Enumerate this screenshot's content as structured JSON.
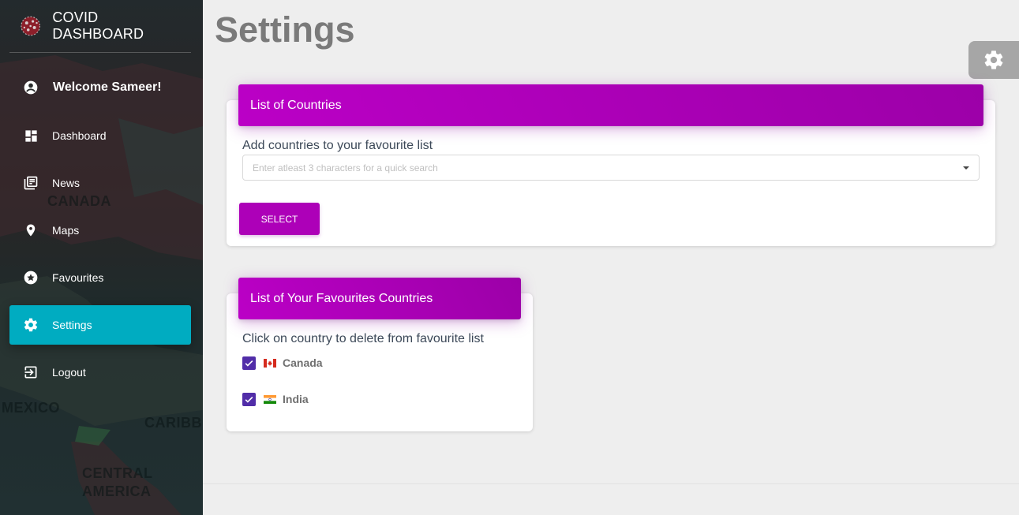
{
  "app": {
    "brand_title": "COVID DASHBOARD"
  },
  "sidebar": {
    "welcome": "Welcome Sameer!",
    "items": [
      {
        "label": "Dashboard",
        "icon": "dashboard-icon",
        "active": false
      },
      {
        "label": "News",
        "icon": "news-icon",
        "active": false
      },
      {
        "label": "Maps",
        "icon": "location-pin-icon",
        "active": false
      },
      {
        "label": "Favourites",
        "icon": "star-icon",
        "active": false
      },
      {
        "label": "Settings",
        "icon": "gear-icon",
        "active": true
      },
      {
        "label": "Logout",
        "icon": "logout-icon",
        "active": false
      }
    ],
    "map_labels": [
      "CANADA",
      "MEXICO",
      "CARIBBE",
      "CENTRAL",
      "AMERICA"
    ],
    "active_color": "#00acc1"
  },
  "page": {
    "title": "Settings"
  },
  "countries_card": {
    "header": "List of Countries",
    "instruction": "Add countries to your favourite list",
    "search_placeholder": "Enter atleast 3 characters for a quick search",
    "select_label": "SELECT"
  },
  "favourites_card": {
    "header": "List of Your Favourites Countries",
    "instruction": "Click on country to delete from favourite list",
    "countries": [
      {
        "name": "Canada",
        "flag": "canada-flag",
        "checked": true
      },
      {
        "name": "India",
        "flag": "india-flag",
        "checked": true
      }
    ]
  },
  "colors": {
    "header_purple": "#ad00b8",
    "checkbox": "#512da8",
    "title_gray": "#7a7a7a"
  }
}
